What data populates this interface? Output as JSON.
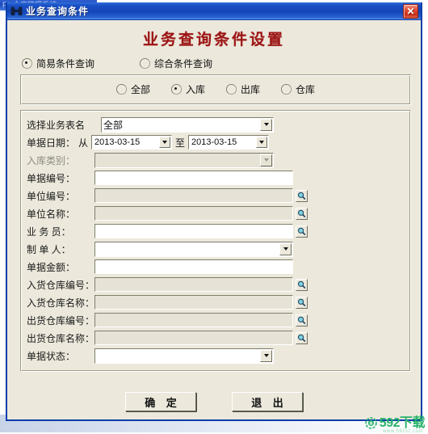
{
  "background": {
    "behind_window_title": "PL 仓库管理系统"
  },
  "window": {
    "title": "业务查询条件",
    "icon": "binoculars-icon",
    "close_label": "✕",
    "header_title": "业务查询条件设置",
    "header_color": "#9c1414",
    "titlebar_color": "#1345b8",
    "client_bg": "#ece9dc"
  },
  "query_mode": {
    "options": [
      {
        "label": "简易条件查询",
        "checked": true
      },
      {
        "label": "综合条件查询",
        "checked": false
      }
    ]
  },
  "business_type": {
    "options": [
      {
        "label": "全部",
        "checked": false
      },
      {
        "label": "入库",
        "checked": true
      },
      {
        "label": "出库",
        "checked": false
      },
      {
        "label": "仓库",
        "checked": false
      }
    ]
  },
  "fields": {
    "table_name": {
      "label": "选择业务表名",
      "value": "全部",
      "control": "combo",
      "disabled": false
    },
    "doc_date": {
      "label": "单据日期：",
      "from_prefix": "从",
      "from_value": "2013-03-15",
      "to_prefix": "至",
      "to_value": "2013-03-15"
    },
    "in_category": {
      "label": "入库类别：",
      "value": "",
      "control": "combo",
      "disabled": true
    },
    "doc_number": {
      "label": "单据编号：",
      "value": "",
      "control": "input",
      "disabled": false
    },
    "unit_number": {
      "label": "单位编号：",
      "value": "",
      "control": "input",
      "disabled": true,
      "search": true
    },
    "unit_name": {
      "label": "单位名称：",
      "value": "",
      "control": "input",
      "disabled": true,
      "search": true
    },
    "salesperson": {
      "label": "业 务 员：",
      "value": "",
      "control": "input",
      "disabled": false,
      "search": true
    },
    "maker": {
      "label": "制 单 人：",
      "value": "",
      "control": "combo",
      "disabled": false
    },
    "doc_amount": {
      "label": "单据金额：",
      "value": "",
      "control": "input",
      "disabled": false
    },
    "in_wh_number": {
      "label": "入货仓库编号：",
      "value": "",
      "control": "input",
      "disabled": true,
      "search": true
    },
    "in_wh_name": {
      "label": "入货仓库名称：",
      "value": "",
      "control": "input",
      "disabled": true,
      "search": true
    },
    "out_wh_number": {
      "label": "出货仓库编号：",
      "value": "",
      "control": "input",
      "disabled": true,
      "search": true
    },
    "out_wh_name": {
      "label": "出货仓库名称：",
      "value": "",
      "control": "input",
      "disabled": true,
      "search": true
    },
    "doc_status": {
      "label": "单据状态：",
      "value": "",
      "control": "combo",
      "disabled": false
    }
  },
  "buttons": {
    "ok": "确 定",
    "exit": "退 出"
  },
  "watermark": {
    "text": "592下载",
    "sub": "www.592xz.com",
    "color": "#28b36a"
  }
}
